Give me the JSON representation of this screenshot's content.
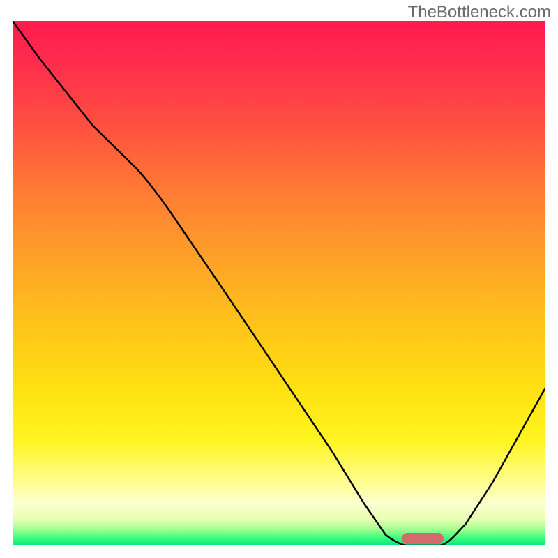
{
  "watermark": "TheBottleneck.com",
  "chart_data": {
    "type": "line",
    "title": "",
    "xlabel": "",
    "ylabel": "",
    "xlim": [
      0,
      100
    ],
    "ylim": [
      0,
      100
    ],
    "background": "gradient",
    "gradient_stops": [
      {
        "pos": 0,
        "color": "#ff1a4d"
      },
      {
        "pos": 50,
        "color": "#ffb020"
      },
      {
        "pos": 85,
        "color": "#fff520"
      },
      {
        "pos": 100,
        "color": "#00e878"
      }
    ],
    "series": [
      {
        "name": "bottleneck-curve",
        "color": "#000000",
        "x": [
          0,
          5,
          15,
          23,
          30,
          40,
          50,
          60,
          66,
          70,
          74,
          80,
          85,
          90,
          100
        ],
        "y": [
          100,
          93,
          80,
          72,
          62,
          48,
          33,
          18,
          8,
          2,
          0,
          0,
          4,
          12,
          30
        ]
      }
    ],
    "marker": {
      "name": "optimal-range",
      "x_center": 77,
      "y": 0.5,
      "width_x": 8,
      "color": "#d36b6b"
    }
  }
}
